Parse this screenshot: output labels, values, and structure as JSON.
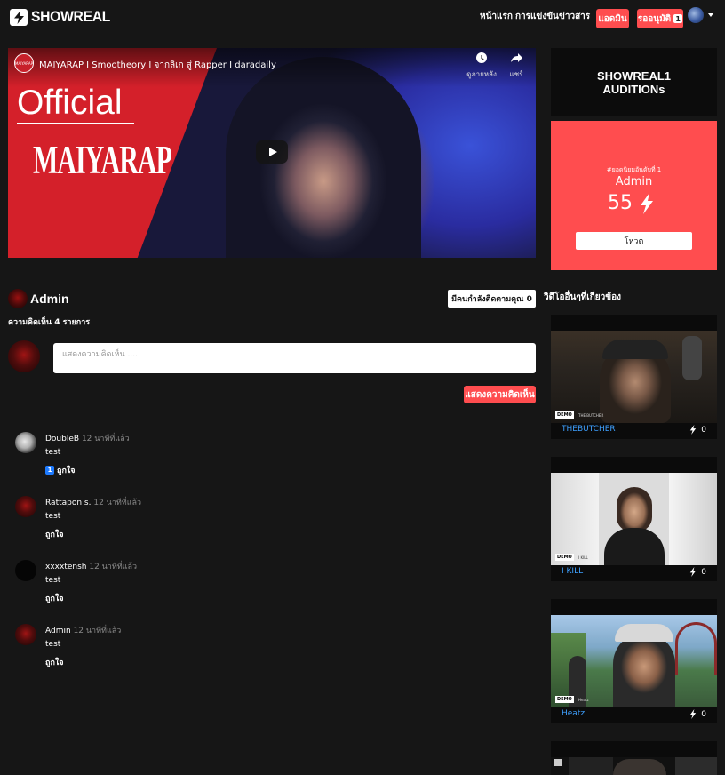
{
  "nav": {
    "brand": "SHOWREAL",
    "links": [
      "หน้าแรก",
      "การแข่งขัน",
      "ข่าวสาร"
    ],
    "admin_button": "แอดมิน",
    "pending_button": "รออนุมัติ",
    "pending_count": "1"
  },
  "video": {
    "title": "MAIYARAP I Smootheory I จากลิเก สู่ Rapper I daradaily",
    "channel_badge": "MAIYARAP",
    "overlay_official": "Official",
    "overlay_brand": "MAIYARAP",
    "watch_later_label": "ดูภายหลัง",
    "share_label": "แชร์"
  },
  "audition": {
    "line1": "SHOWREAL1",
    "line2": "AUDITIONs"
  },
  "top_card": {
    "label": "#ยอดนิยมอันดับที่ 1",
    "name": "Admin",
    "score": "55",
    "vote_button": "โหวต"
  },
  "profile": {
    "name": "Admin",
    "follow_button": "มีคนกำลังติดตามคุณ 0",
    "comment_count": "ความคิดเห็น 4 รายการ"
  },
  "comment_form": {
    "placeholder": "แสดงความคิดเห็น ....",
    "submit_label": "แสดงความคิดเห็น"
  },
  "comments": [
    {
      "name": "DoubleB",
      "time": "12 นาทีที่แล้ว",
      "text": "test",
      "likes": "1",
      "like_label": "ถูกใจ"
    },
    {
      "name": "Rattapon s.",
      "time": "12 นาทีที่แล้ว",
      "text": "test",
      "likes": "",
      "like_label": "ถูกใจ"
    },
    {
      "name": "xxxxtensh",
      "time": "12 นาทีที่แล้ว",
      "text": "test",
      "likes": "",
      "like_label": "ถูกใจ"
    },
    {
      "name": "Admin",
      "time": "12 นาทีที่แล้ว",
      "text": "test",
      "likes": "",
      "like_label": "ถูกใจ"
    }
  ],
  "related": {
    "title": "วิดีโออื่นๆที่เกี่ยวข้อง",
    "videos": [
      {
        "name": "THEBUTCHER",
        "count": "0",
        "tag": "DEMO",
        "sub": "THE BUTCHER"
      },
      {
        "name": "I KILL",
        "count": "0",
        "tag": "DEMO",
        "sub": "I KILL"
      },
      {
        "name": "Heatz",
        "count": "0",
        "tag": "DEMO",
        "sub": "Heatz"
      }
    ]
  },
  "colors": {
    "accent": "#ff4d4f",
    "background": "#161616",
    "link": "#3ea0ff",
    "badge": "#1e7bff"
  },
  "icons": [
    "bolt-icon",
    "clock-icon",
    "share-icon",
    "play-icon",
    "caret-down-icon"
  ]
}
